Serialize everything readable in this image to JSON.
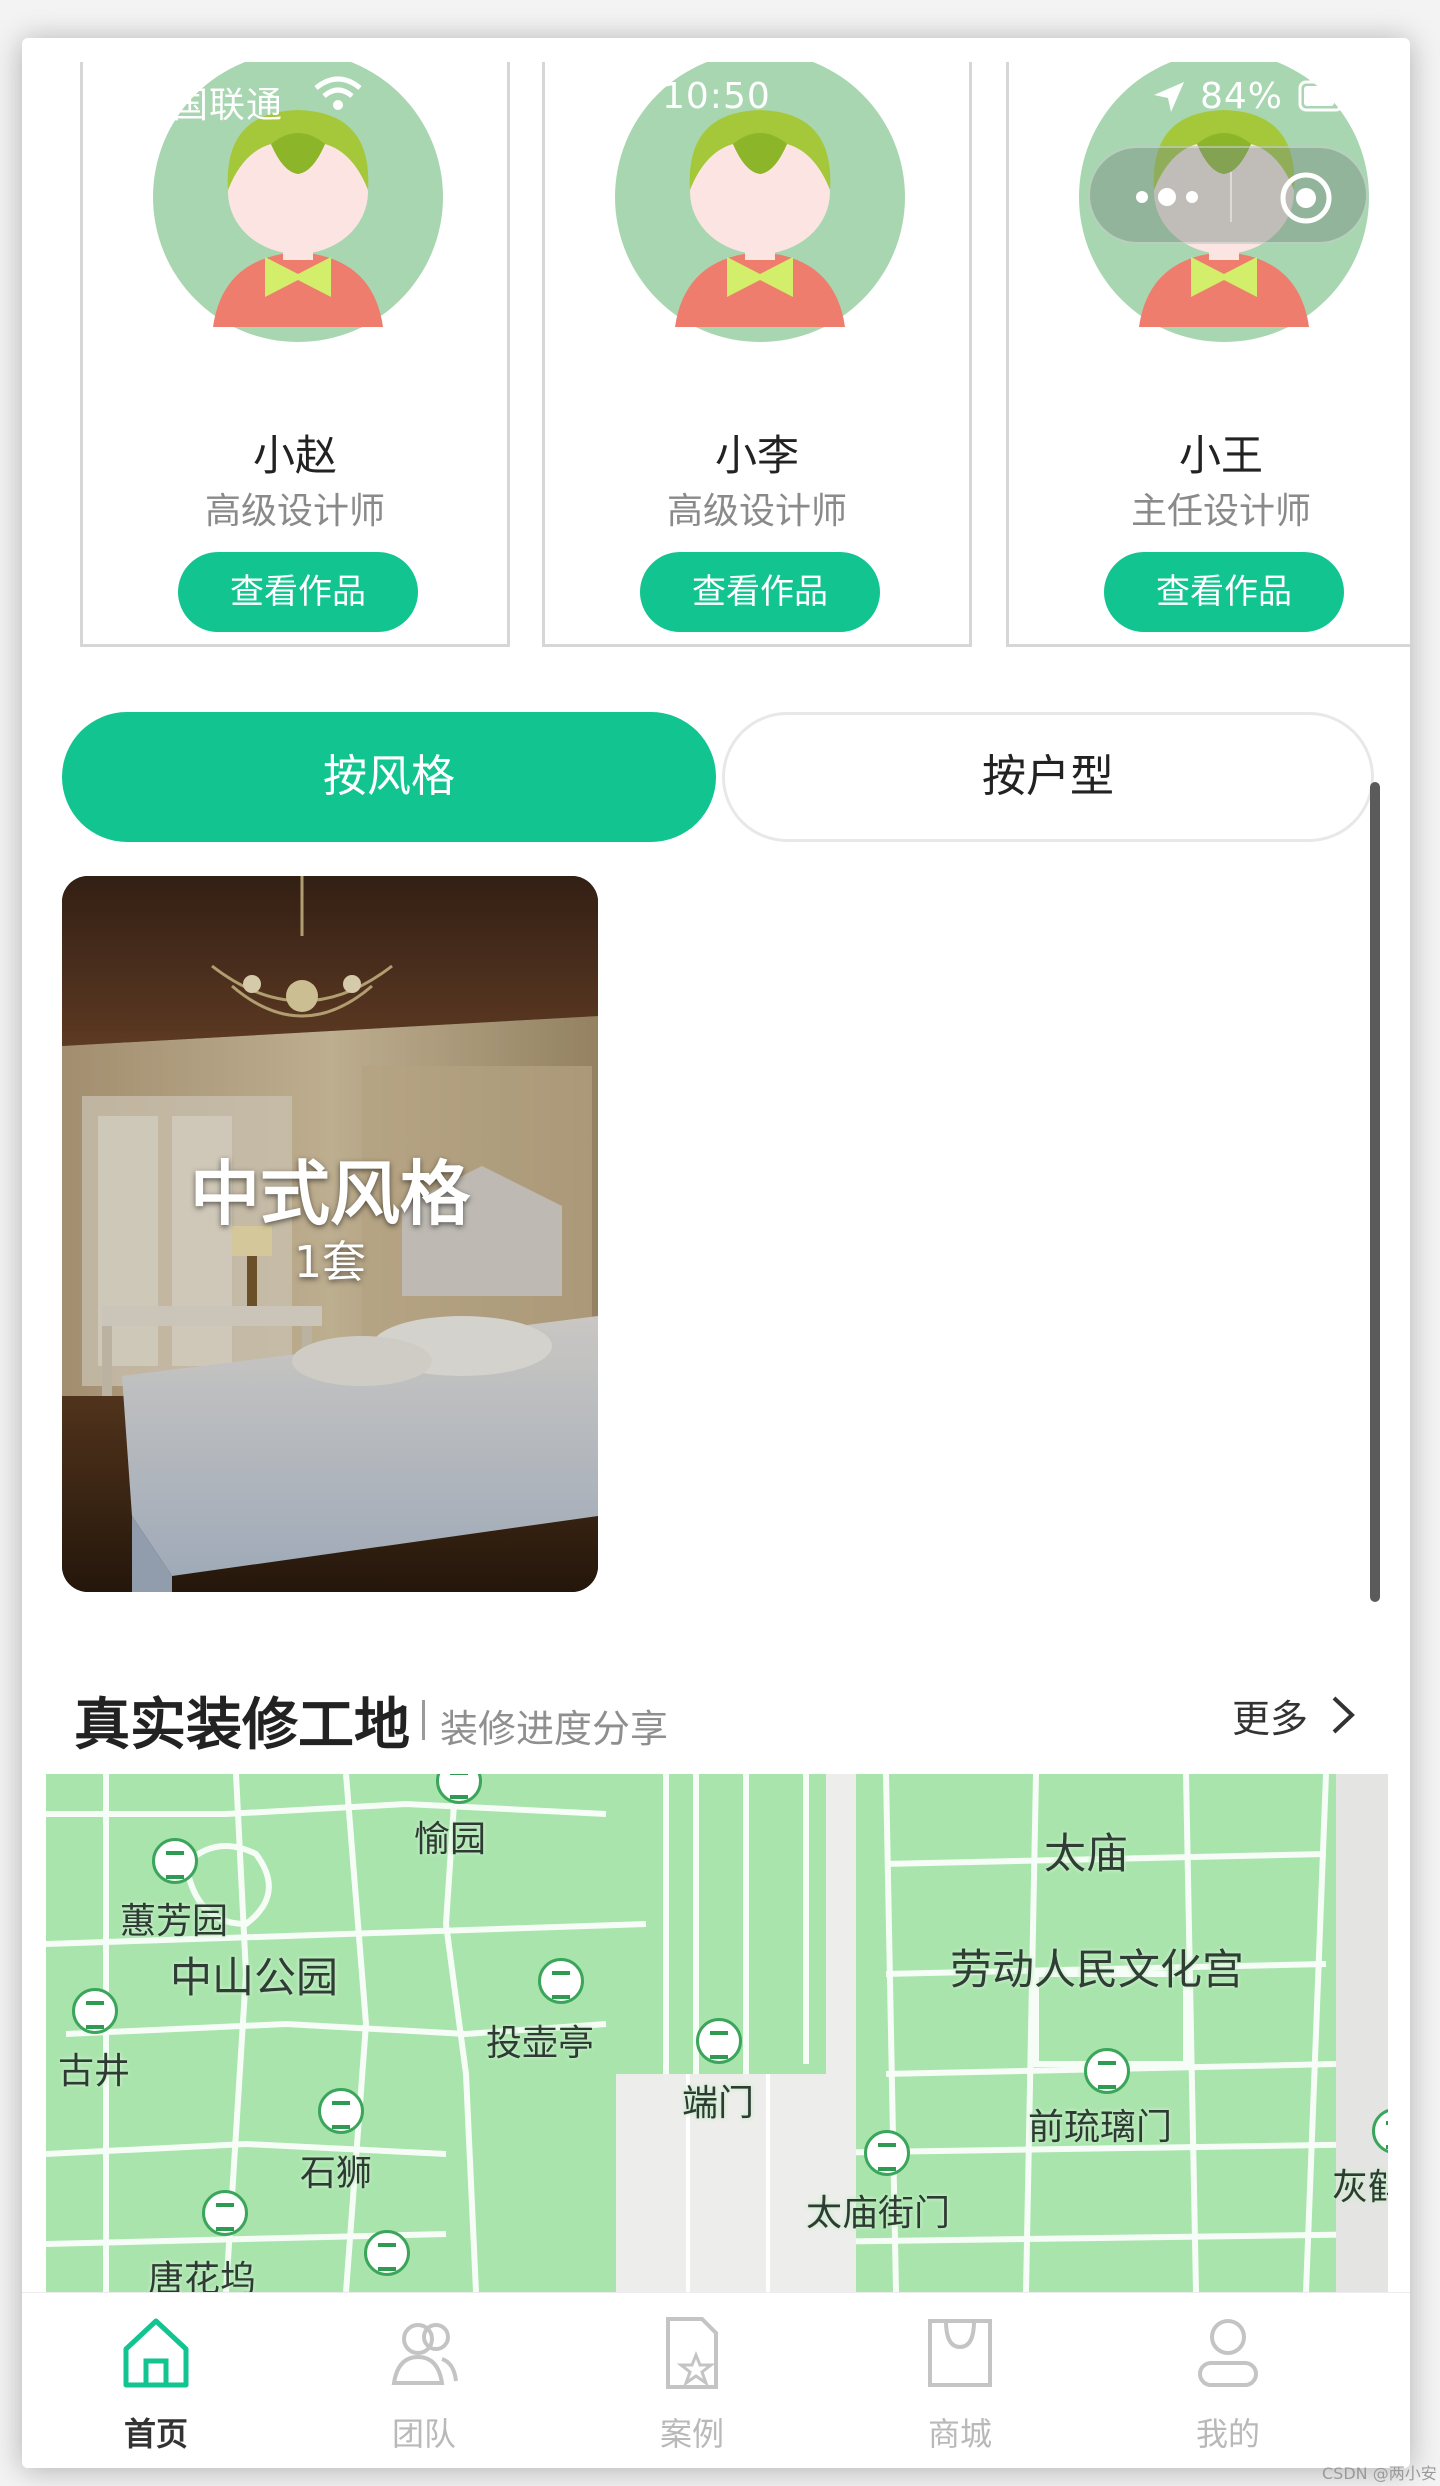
{
  "status_bar": {
    "carrier": "国联通",
    "time": "10:50",
    "battery": "84%"
  },
  "designers": [
    {
      "name": "小赵",
      "title": "高级设计师",
      "button": "查看作品"
    },
    {
      "name": "小李",
      "title": "高级设计师",
      "button": "查看作品"
    },
    {
      "name": "小王",
      "title": "主任设计师",
      "button": "查看作品"
    }
  ],
  "tabs": [
    {
      "label": "按风格",
      "active": true
    },
    {
      "label": "按户型",
      "active": false
    }
  ],
  "style_cards": [
    {
      "title": "中式风格",
      "count": "1套"
    }
  ],
  "section": {
    "title": "真实装修工地",
    "subtitle": "装修进度分享",
    "more": "更多"
  },
  "map_labels": [
    "愉园",
    "蕙芳园",
    "中山公园",
    "古井",
    "投壶亭",
    "端门",
    "石狮",
    "唐花坞",
    "太庙",
    "劳动人民文化宫",
    "前琉璃门",
    "太庙街门",
    "灰鹤"
  ],
  "bottom_nav": [
    {
      "label": "首页",
      "icon": "home-icon",
      "active": true
    },
    {
      "label": "团队",
      "icon": "team-icon",
      "active": false
    },
    {
      "label": "案例",
      "icon": "case-icon",
      "active": false
    },
    {
      "label": "商城",
      "icon": "shop-icon",
      "active": false
    },
    {
      "label": "我的",
      "icon": "profile-icon",
      "active": false
    }
  ],
  "watermark": "CSDN @两小安",
  "colors": {
    "accent": "#12c48f",
    "map_green": "#a8e4ab",
    "avatar_bg": "#a8d6b0"
  }
}
